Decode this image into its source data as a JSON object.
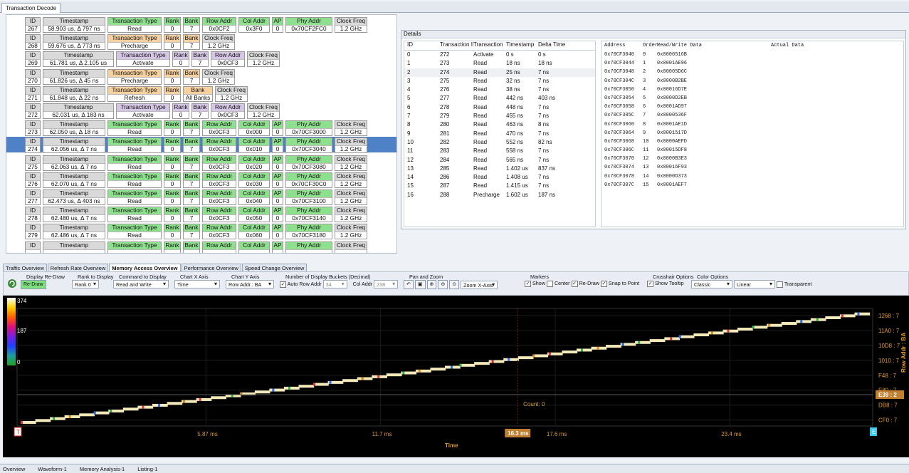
{
  "window": {
    "tab": "Transaction Decode"
  },
  "transactions": [
    {
      "id": "267",
      "ts": "58.903 us, Δ 797 ns",
      "type": "Read",
      "rank": "0",
      "bank": "7",
      "row": "0x0CF2",
      "col": "0x3F0",
      "ap": "0",
      "phy": "0x70CF2FC0",
      "clk": "1.2 GHz",
      "kind": "read"
    },
    {
      "id": "268",
      "ts": "59.676 us, Δ 773 ns",
      "type": "Precharge",
      "rank": "0",
      "bank": "7",
      "clk": "1.2 GHz",
      "kind": "pre"
    },
    {
      "id": "269",
      "ts": "61.781 us, Δ 2.105 us",
      "type": "Activate",
      "rank": "0",
      "bank": "7",
      "row": "0x0CF3",
      "clk": "1.2 GHz",
      "kind": "act"
    },
    {
      "id": "270",
      "ts": "61.826 us, Δ 45 ns",
      "type": "Precharge",
      "rank": "0",
      "bank": "7",
      "clk": "1.2 GHz",
      "kind": "pre"
    },
    {
      "id": "271",
      "ts": "61.848 us, Δ 22 ns",
      "type": "Refresh",
      "rank": "0",
      "bank": "All Banks",
      "clk": "1.2 GHz",
      "kind": "ref"
    },
    {
      "id": "272",
      "ts": "62.031 us, Δ 183 ns",
      "type": "Activate",
      "rank": "0",
      "bank": "7",
      "row": "0x0CF3",
      "clk": "1.2 GHz",
      "kind": "act"
    },
    {
      "id": "273",
      "ts": "62.050 us, Δ 18 ns",
      "type": "Read",
      "rank": "0",
      "bank": "7",
      "row": "0x0CF3",
      "col": "0x000",
      "ap": "0",
      "phy": "0x70CF3000",
      "clk": "1.2 GHz",
      "kind": "read"
    },
    {
      "id": "274",
      "ts": "62.056 us, Δ 7 ns",
      "type": "Read",
      "rank": "0",
      "bank": "7",
      "row": "0x0CF3",
      "col": "0x010",
      "ap": "0",
      "phy": "0x70CF3040",
      "clk": "1.2 GHz",
      "kind": "read",
      "sel": true
    },
    {
      "id": "275",
      "ts": "62.063 us, Δ 7 ns",
      "type": "Read",
      "rank": "0",
      "bank": "7",
      "row": "0x0CF3",
      "col": "0x020",
      "ap": "0",
      "phy": "0x70CF3080",
      "clk": "1.2 GHz",
      "kind": "read"
    },
    {
      "id": "276",
      "ts": "62.070 us, Δ 7 ns",
      "type": "Read",
      "rank": "0",
      "bank": "7",
      "row": "0x0CF3",
      "col": "0x030",
      "ap": "0",
      "phy": "0x70CF30C0",
      "clk": "1.2 GHz",
      "kind": "read"
    },
    {
      "id": "277",
      "ts": "62.473 us, Δ 403 ns",
      "type": "Read",
      "rank": "0",
      "bank": "7",
      "row": "0x0CF3",
      "col": "0x040",
      "ap": "0",
      "phy": "0x70CF3100",
      "clk": "1.2 GHz",
      "kind": "read"
    },
    {
      "id": "278",
      "ts": "62.480 us, Δ 7 ns",
      "type": "Read",
      "rank": "0",
      "bank": "7",
      "row": "0x0CF3",
      "col": "0x050",
      "ap": "0",
      "phy": "0x70CF3140",
      "clk": "1.2 GHz",
      "kind": "read"
    },
    {
      "id": "279",
      "ts": "62.486 us, Δ 7 ns",
      "type": "Read",
      "rank": "0",
      "bank": "7",
      "row": "0x0CF3",
      "col": "0x060",
      "ap": "0",
      "phy": "0x70CF3180",
      "clk": "1.2 GHz",
      "kind": "read"
    },
    {
      "id": "",
      "ts": "",
      "type": "",
      "rank": "",
      "bank": "",
      "row": "",
      "col": "",
      "ap": "",
      "phy": "",
      "clk": "",
      "kind": "read"
    }
  ],
  "labels": {
    "id": "ID",
    "ts": "Timestamp",
    "type": "Transaction Type",
    "rank": "Rank",
    "bank": "Bank",
    "row": "Row Addr",
    "col": "Col Addr",
    "ap": "AP",
    "phy": "Phy Addr",
    "clk": "Clock Freq"
  },
  "details": {
    "title": "Details",
    "headers": [
      "ID",
      "Transaction ID",
      "Transaction",
      "Timestamp",
      "Delta Time"
    ],
    "rows": [
      [
        "0",
        "272",
        "Activate",
        "0 s",
        "0 s"
      ],
      [
        "1",
        "273",
        "Read",
        "18 ns",
        "18 ns"
      ],
      [
        "2",
        "274",
        "Read",
        "25 ns",
        "7 ns"
      ],
      [
        "3",
        "275",
        "Read",
        "32 ns",
        "7 ns"
      ],
      [
        "4",
        "276",
        "Read",
        "38 ns",
        "7 ns"
      ],
      [
        "5",
        "277",
        "Read",
        "442 ns",
        "403 ns"
      ],
      [
        "6",
        "278",
        "Read",
        "448 ns",
        "7 ns"
      ],
      [
        "7",
        "279",
        "Read",
        "455 ns",
        "7 ns"
      ],
      [
        "8",
        "280",
        "Read",
        "463 ns",
        "8 ns"
      ],
      [
        "9",
        "281",
        "Read",
        "470 ns",
        "7 ns"
      ],
      [
        "10",
        "282",
        "Read",
        "552 ns",
        "82 ns"
      ],
      [
        "11",
        "283",
        "Read",
        "558 ns",
        "7 ns"
      ],
      [
        "12",
        "284",
        "Read",
        "565 ns",
        "7 ns"
      ],
      [
        "13",
        "285",
        "Read",
        "1.402 us",
        "837 ns"
      ],
      [
        "14",
        "286",
        "Read",
        "1.408 us",
        "7 ns"
      ],
      [
        "15",
        "287",
        "Read",
        "1.415 us",
        "7 ns"
      ],
      [
        "16",
        "288",
        "Precharge",
        "1.602 us",
        "187 ns"
      ]
    ],
    "data_headers": [
      "Address",
      "Order",
      "Read/Write Data",
      "Actual Data"
    ],
    "data_rows": [
      [
        "0x70CF3040",
        "0",
        "0x0000516B"
      ],
      [
        "0x70CF3044",
        "1",
        "0x0001AE96"
      ],
      [
        "0x70CF3048",
        "2",
        "0x00005D6C"
      ],
      [
        "0x70CF304C",
        "3",
        "0x0000B2BE"
      ],
      [
        "0x70CF3050",
        "4",
        "0x00016D7E"
      ],
      [
        "0x70CF3054",
        "5",
        "0x0000D2EB"
      ],
      [
        "0x70CF3058",
        "6",
        "0x0001AD97"
      ],
      [
        "0x70CF305C",
        "7",
        "0x0000536F"
      ],
      [
        "0x70CF3060",
        "8",
        "0x0001AE1D"
      ],
      [
        "0x70CF3064",
        "9",
        "0x0001517D"
      ],
      [
        "0x70CF3068",
        "10",
        "0x0000AEFD"
      ],
      [
        "0x70CF306C",
        "11",
        "0x00015DF8"
      ],
      [
        "0x70CF3070",
        "12",
        "0x0000B3E3"
      ],
      [
        "0x70CF3074",
        "13",
        "0x00016F93"
      ],
      [
        "0x70CF3078",
        "14",
        "0x0000D373"
      ],
      [
        "0x70CF307C",
        "15",
        "0x0001AEF7"
      ]
    ]
  },
  "analysis_tabs": [
    "Traffic Overview",
    "Refresh Rate Overview",
    "Memory Access Overview",
    "Performance Overview",
    "Speed Change Overview"
  ],
  "toolbar": {
    "redraw_label": "Display Re-Draw",
    "redraw_btn": "Re-Draw",
    "rank_label": "Rank to Display",
    "rank_val": "Rank 0",
    "cmd_label": "Command to Display",
    "cmd_val": "Read and Write",
    "x_label": "Chart X Axis",
    "x_val": "Time",
    "y_label": "Chart Y Axis",
    "y_val": "Row Addr.: BA",
    "buckets_label": "Number of Display Buckets (Decimal)",
    "auto": "Auto",
    "row_addr": "Row Addr",
    "row_val": "34",
    "col_addr": "Col Addr",
    "col_val": "238",
    "pan_label": "Pan and Zoom",
    "zoom_val": "Zoom X-Axis",
    "markers_label": "Markers",
    "show": "Show",
    "center": "Center",
    "redraw": "Re-Draw",
    "snap": "Snap to Point",
    "cross_label": "Crosshair Options",
    "tooltip": "Show Tooltip",
    "color_label": "Color Options",
    "color_val": "Classic",
    "scale_val": "Linear",
    "transparent": "Transparent"
  },
  "chart_data": {
    "type": "scatter",
    "xlabel": "Time",
    "ylabel": "Row Addr : BA",
    "x_ticks": [
      "5.87 ms",
      "11.7 ms",
      "17.6 ms",
      "23.4 ms"
    ],
    "y_ticks": [
      "1268 : 7",
      "11A0 : 7",
      "10D8 : 7",
      "1010 : 7",
      "F48 : 7",
      "E80 : 7",
      "DB8 : 7",
      "CF0 : 7"
    ],
    "cursor_x": "16.3 ms",
    "cursor_y": "E39 : 2",
    "count": "Count: 0",
    "marker_start": "T",
    "marker_end": "E",
    "legend": {
      "max": "374",
      "mid": "187",
      "min": "0"
    }
  },
  "statusbar": [
    "Overview",
    "Waveform-1",
    "Memory Analysis-1",
    "Listing-1"
  ]
}
